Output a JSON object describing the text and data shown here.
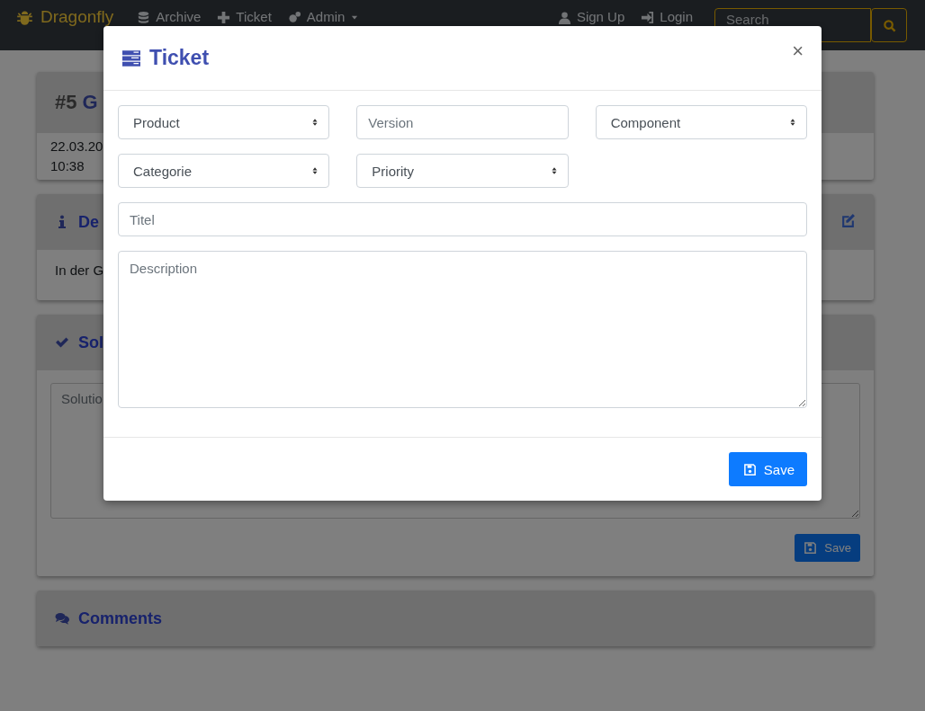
{
  "navbar": {
    "brand": "Dragonfly",
    "items": [
      {
        "label": "Archive"
      },
      {
        "label": "Ticket"
      },
      {
        "label": "Admin",
        "dropdown": true
      }
    ],
    "right_items": [
      {
        "label": "Sign Up"
      },
      {
        "label": "Login"
      }
    ],
    "search": {
      "placeholder": "Search"
    }
  },
  "ticket": {
    "number": "#5",
    "title": "G",
    "meta": [
      "22.03.20",
      "10:38"
    ]
  },
  "description_card": {
    "heading": "De",
    "text": "In der G"
  },
  "solution_card": {
    "heading": "Sol",
    "placeholder": "Solutio",
    "save": "Save"
  },
  "comments_card": {
    "heading": "Comments"
  },
  "modal": {
    "title": "Ticket",
    "close": "×",
    "fields": [
      {
        "kind": "select",
        "label": "Product"
      },
      {
        "kind": "input",
        "placeholder": "Version"
      },
      {
        "kind": "select",
        "label": "Component"
      },
      {
        "kind": "select",
        "label": "Categorie"
      },
      {
        "kind": "select",
        "label": "Priority"
      }
    ],
    "title_field": {
      "placeholder": "Titel"
    },
    "description_field": {
      "placeholder": "Description"
    },
    "save": "Save"
  }
}
